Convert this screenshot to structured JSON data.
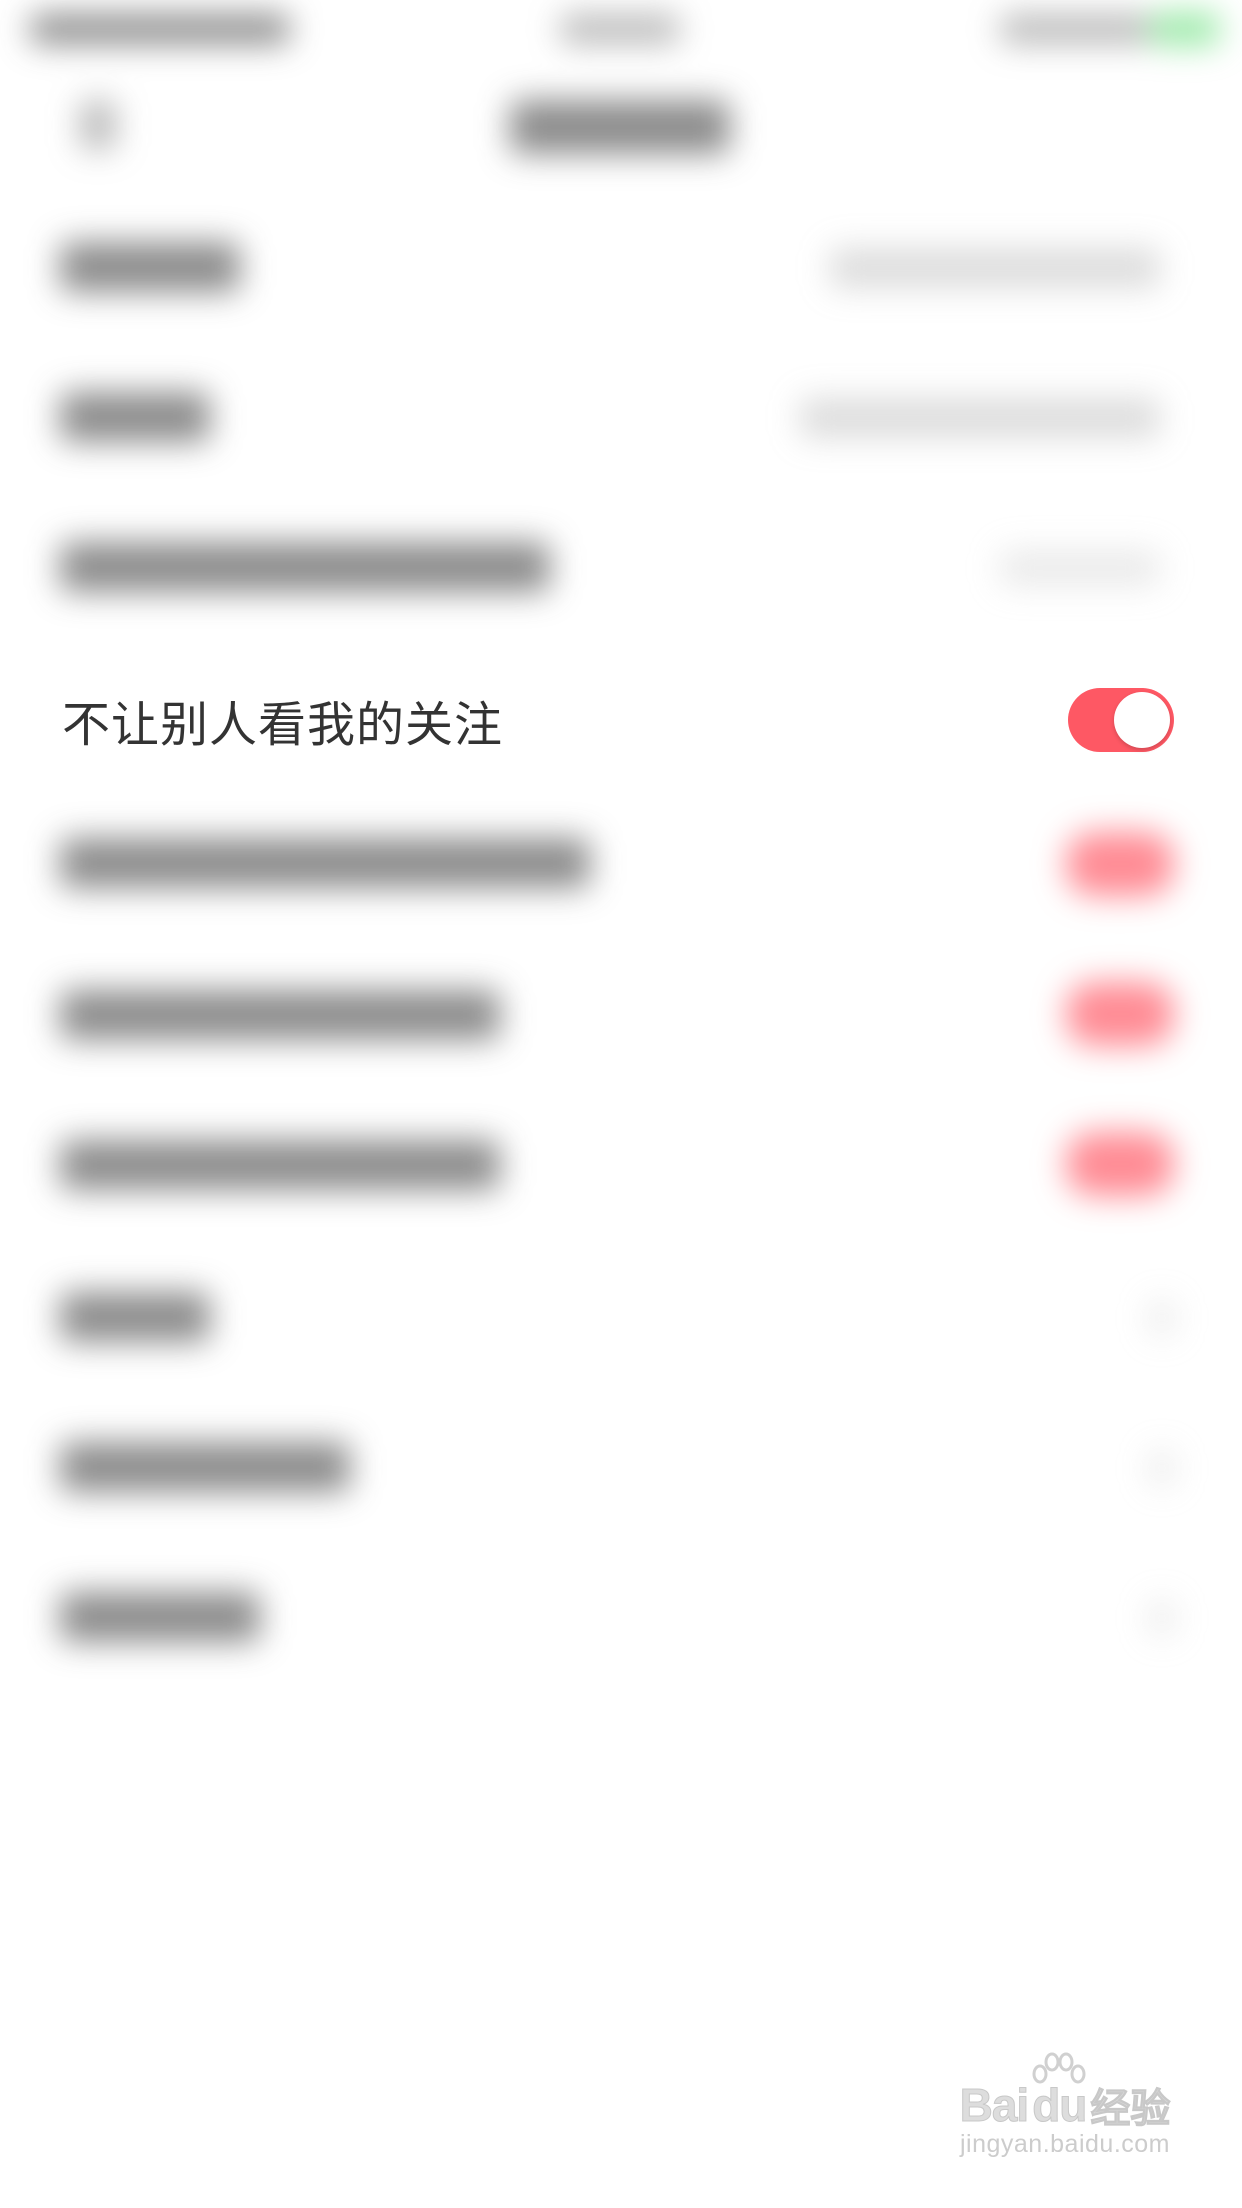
{
  "focused_setting": {
    "label": "不让别人看我的关注",
    "toggle_on": true
  },
  "watermark": {
    "logo_text": "Bai",
    "logo_suffix": "du",
    "product": "经验",
    "url": "jingyan.baidu.com"
  },
  "colors": {
    "accent": "#fe5864",
    "text": "#333333",
    "background": "#ffffff"
  }
}
